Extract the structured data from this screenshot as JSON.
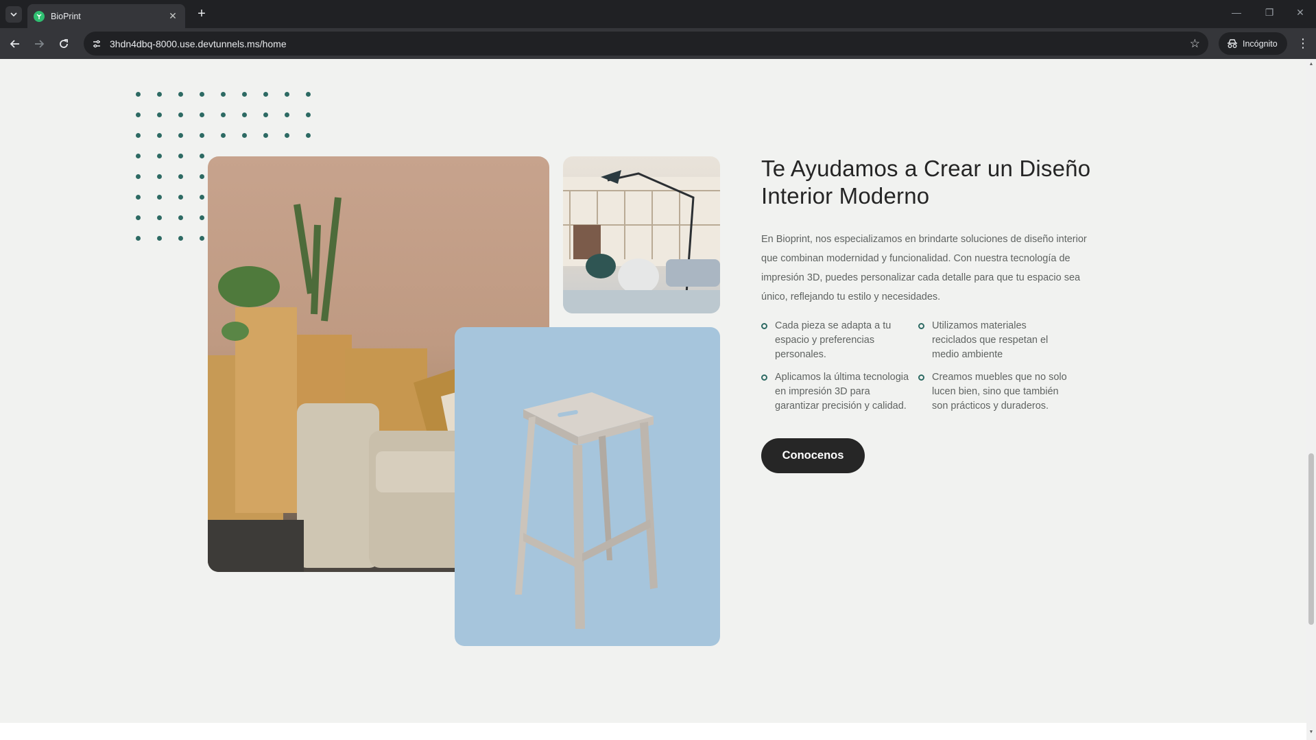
{
  "browser": {
    "tab_title": "BioPrint",
    "url": "3hdn4dbq-8000.use.devtunnels.ms/home",
    "incognito_label": "Incógnito"
  },
  "section": {
    "heading": "Te Ayudamos a Crear un Diseño Interior Moderno",
    "description": "En Bioprint, nos especializamos en brindarte soluciones de diseño interior que combinan modernidad y funcionalidad. Con nuestra tecnología de impresión 3D, puedes personalizar cada detalle para que tu espacio sea único, reflejando tu estilo y necesidades.",
    "features": [
      "Cada pieza se adapta a tu espacio y preferencias personales.",
      "Utilizamos materiales reciclados que respetan el medio ambiente",
      "Aplicamos la última tecnologia en impresión 3D para garantizar precisión y calidad.",
      "Creamos muebles que no solo lucen bien, sino que también son prácticos y duraderos."
    ],
    "cta_label": "Conocenos"
  },
  "colors": {
    "accent": "#2d6a63",
    "page_bg": "#f1f2f0",
    "button_bg": "#262626"
  },
  "icons": [
    "tab-list-icon",
    "favicon-leaf-icon",
    "close-icon",
    "plus-icon",
    "back-icon",
    "forward-icon",
    "reload-icon",
    "site-info-icon",
    "star-icon",
    "incognito-icon",
    "more-icon"
  ]
}
